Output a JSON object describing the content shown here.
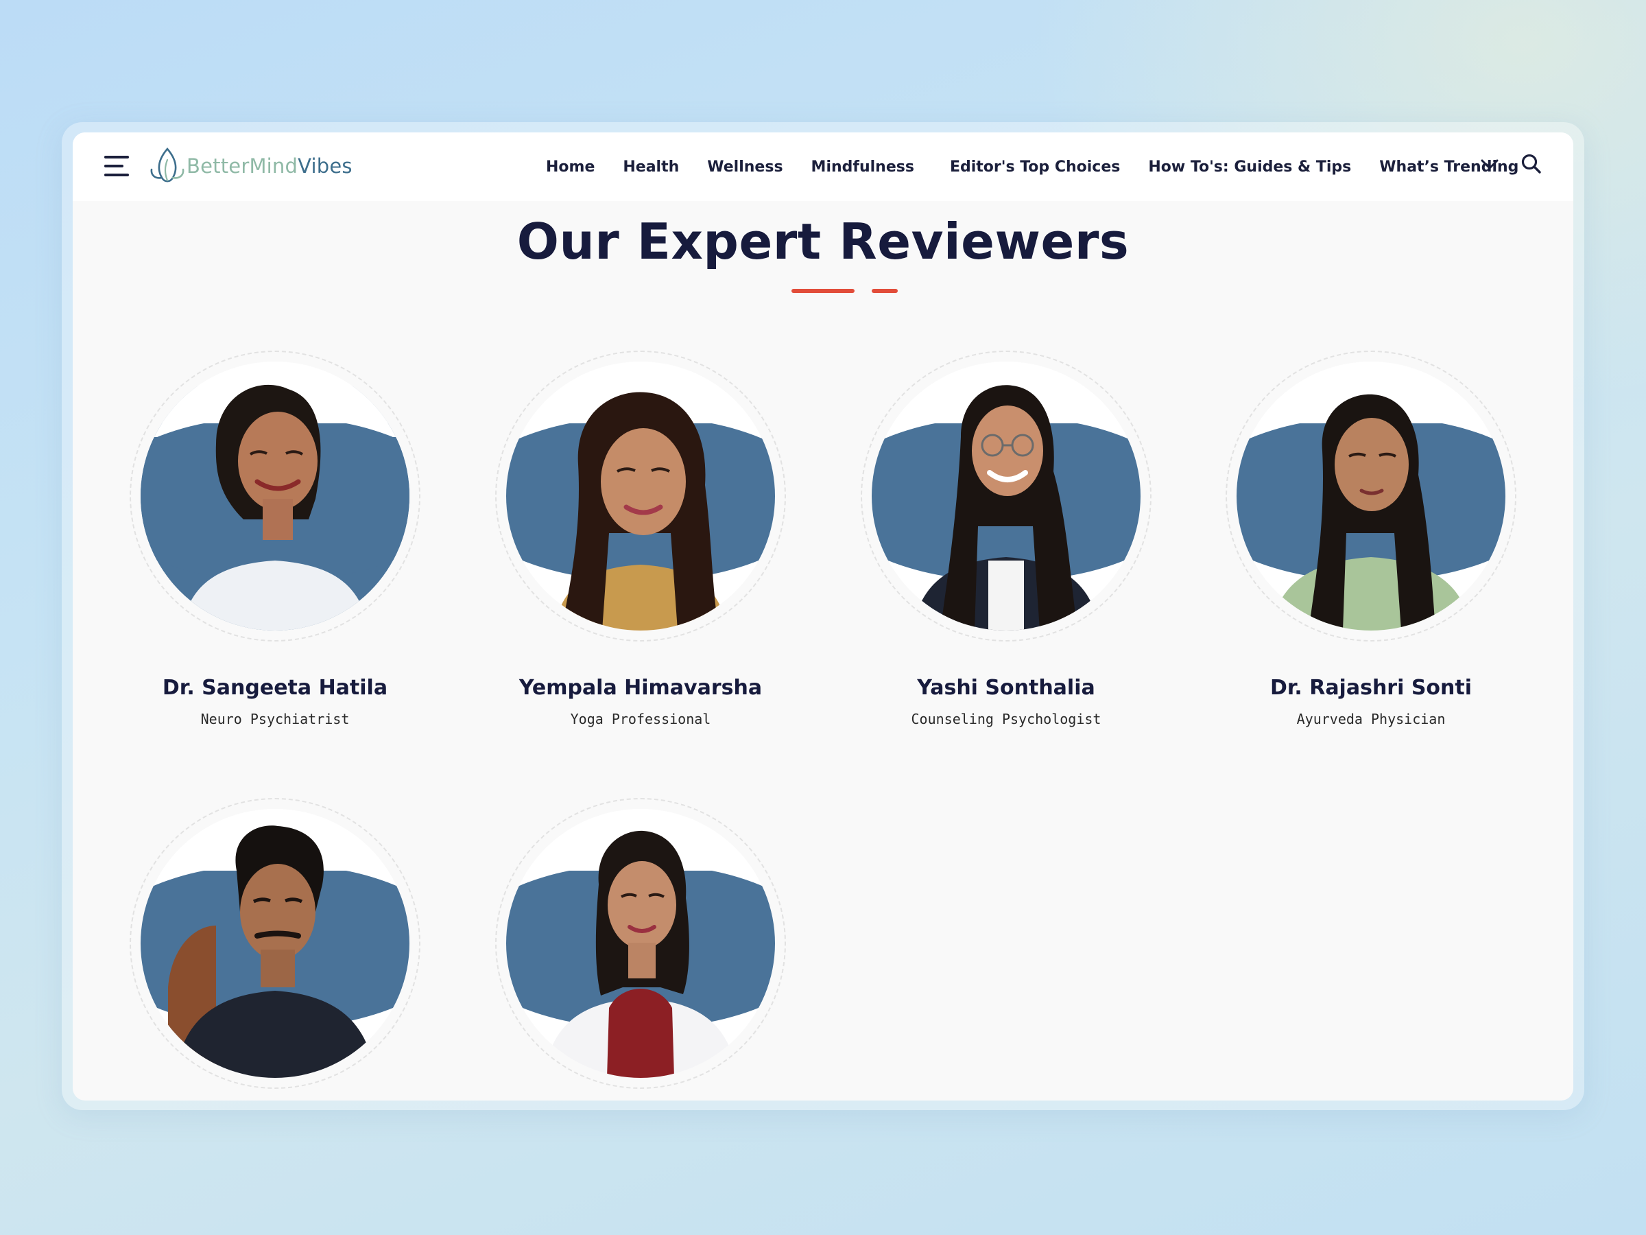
{
  "brand": {
    "name_part1": "BetterMind",
    "name_part2": "Vibes",
    "colors": {
      "logo_blue": "#3d6e8c",
      "logo_green": "#8fb9a6",
      "accent_red": "#e24d3a",
      "avatar_blue": "#4a7399",
      "heading_navy": "#171b3d"
    }
  },
  "header": {
    "menu_icon": "hamburger-menu-icon",
    "nav": [
      {
        "label": "Home"
      },
      {
        "label": "Health"
      },
      {
        "label": "Wellness"
      },
      {
        "label": "Mindfulness"
      },
      {
        "label": "Editor's Top Choices"
      },
      {
        "label": "How To's: Guides & Tips"
      },
      {
        "label": "What’s Trending"
      }
    ],
    "more_icon": "chevron-down-icon",
    "search_icon": "search-icon"
  },
  "section": {
    "title": "Our Expert Reviewers"
  },
  "reviewers": [
    {
      "name": "Dr. Sangeeta Hatila",
      "role": "Neuro Psychiatrist"
    },
    {
      "name": "Yempala Himavarsha",
      "role": "Yoga Professional"
    },
    {
      "name": "Yashi Sonthalia",
      "role": "Counseling Psychologist"
    },
    {
      "name": "Dr. Rajashri Sonti",
      "role": "Ayurveda Physician"
    },
    {
      "name": "",
      "role": ""
    },
    {
      "name": "",
      "role": ""
    }
  ]
}
